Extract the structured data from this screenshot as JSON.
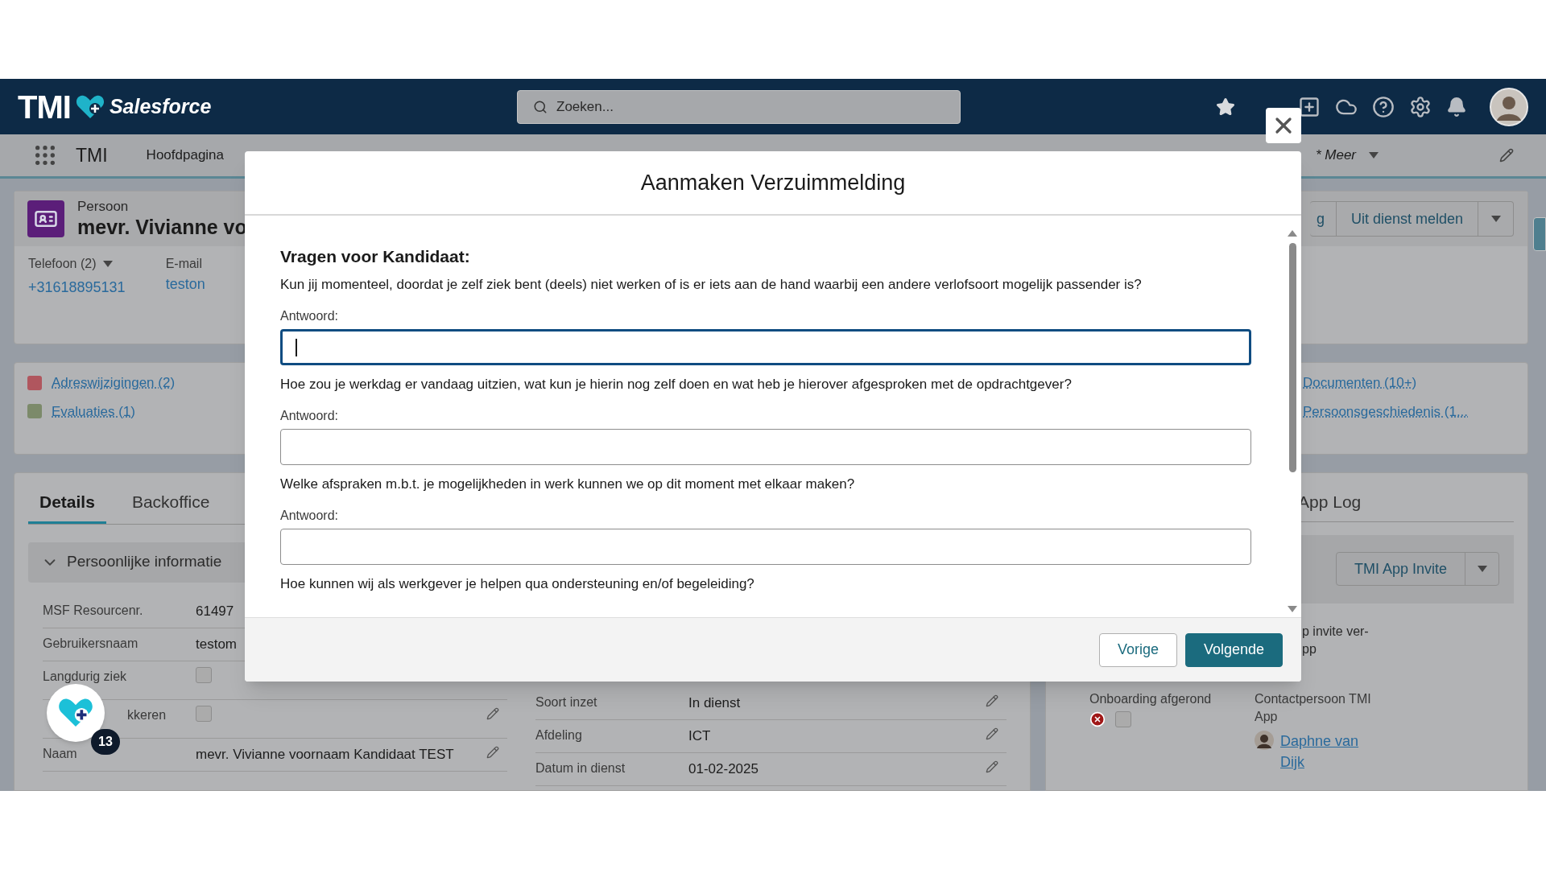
{
  "header": {
    "logo_text": "TMI",
    "brand": "Salesforce",
    "search": {
      "placeholder": "Zoeken..."
    }
  },
  "nav": {
    "app_name": "TMI",
    "items": [
      {
        "label": "Hoofdpagina",
        "selected": false
      }
    ],
    "more": "* Meer"
  },
  "record": {
    "type": "Persoon",
    "name": "mevr. Vivianne vo",
    "phone_label": "Telefoon (2)",
    "phone": "+31618895131",
    "email_label": "E-mail",
    "email": "teston",
    "actions": [
      "g",
      "Uit dienst melden"
    ]
  },
  "related_links": {
    "left": [
      "Adreswijzigingen (2)",
      "Evaluaties (1)"
    ],
    "right": [
      "Documenten (10+)",
      "Persoonsgeschiedenis (1..."
    ]
  },
  "tabs": [
    {
      "label": "Details",
      "selected": true
    },
    {
      "label": "Backoffice",
      "selected": false
    }
  ],
  "section": {
    "title": "Persoonlijke informatie",
    "expanded": true
  },
  "fields_left": [
    {
      "kind": "text",
      "label": "MSF Resourcenr.",
      "value": "61497",
      "editable": false
    },
    {
      "kind": "text",
      "label": "Gebruikersnaam",
      "value": "testom",
      "editable": false
    },
    {
      "kind": "checkbox",
      "label": "Langdurig ziek",
      "checked": false,
      "editable": false
    },
    {
      "kind": "checkbox",
      "label": "kkeren",
      "checked": false,
      "editable": true
    },
    {
      "kind": "text",
      "label": "Naam",
      "value": "mevr. Vivianne voornaam Kandidaat TEST",
      "editable": true
    }
  ],
  "fields_middle": [
    {
      "kind": "text",
      "label": "Soort inzet",
      "value": "In dienst",
      "editable": true
    },
    {
      "kind": "text",
      "label": "Afdeling",
      "value": "ICT",
      "editable": true
    },
    {
      "kind": "text",
      "label": "Datum in dienst",
      "value": "01-02-2025",
      "editable": true
    }
  ],
  "app_panel": {
    "tab": "App Log",
    "invite_button": "TMI App Invite",
    "note_lines": [
      "p invite ver-",
      "pp"
    ],
    "onboarding_label": "Onboarding afgerond",
    "onboarding_error": true,
    "onboarding_checked": false,
    "contact_label": "Contactpersoon TMI App",
    "contact_name": "Daphne van Dijk"
  },
  "floating_button": {
    "badge": "13"
  },
  "modal": {
    "title": "Aanmaken Verzuimmelding",
    "heading": "Vragen voor Kandidaat:",
    "questions": [
      {
        "question": "Kun jij momenteel, doordat je zelf ziek bent (deels) niet werken of is er iets aan de hand waarbij een andere verlofsoort mogelijk passender is?",
        "answer_label": "Antwoord:",
        "focused": true
      },
      {
        "question": "Hoe zou je werkdag er vandaag uitzien, wat kun je hierin nog zelf doen en wat heb je hierover afgesproken met de opdrachtgever?",
        "answer_label": "Antwoord:",
        "focused": false
      },
      {
        "question": "Welke afspraken m.b.t. je mogelijkheden in werk kunnen we op dit moment met elkaar maken?",
        "answer_label": "Antwoord:",
        "focused": false
      },
      {
        "question": "Hoe kunnen wij als werkgever je helpen qua ondersteuning en/of begeleiding?"
      }
    ],
    "buttons": [
      {
        "label": "Vorige",
        "kind": "secondary"
      },
      {
        "label": "Volgende",
        "kind": "primary"
      }
    ]
  }
}
